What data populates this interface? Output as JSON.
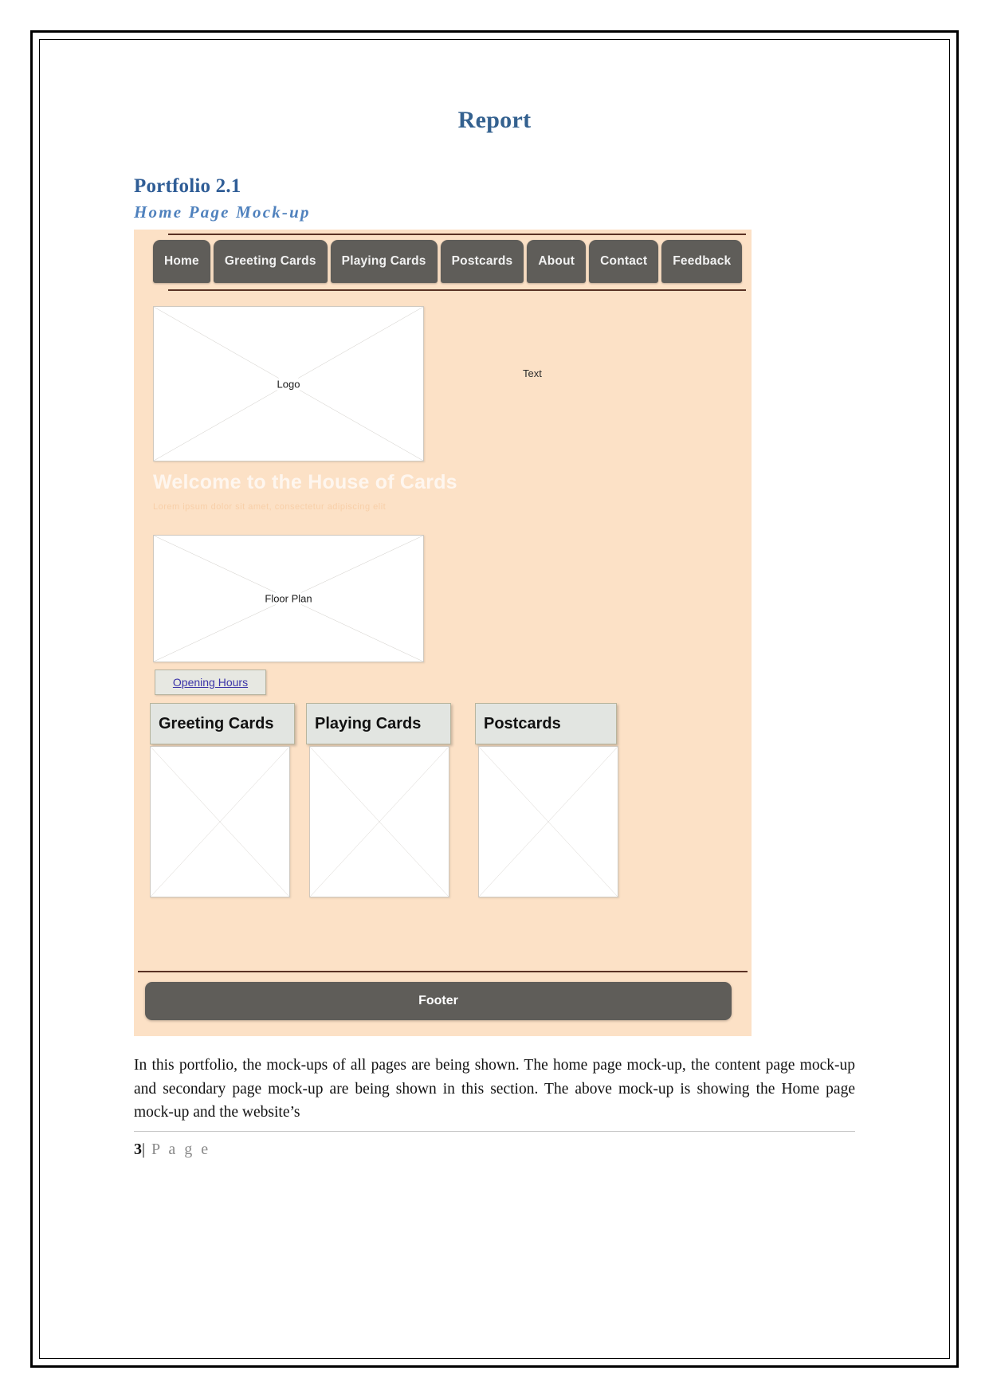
{
  "document": {
    "title": "Report",
    "section_heading": "Portfolio 2.1",
    "sub_heading": "Home Page Mock-up",
    "body_paragraph": "In this portfolio, the mock-ups of all pages are being shown. The home page mock-up, the content page mock-up and secondary page mock-up are being shown in this section. The above mock-up is showing the Home page mock-up and the website’s",
    "page_number": "3",
    "page_separator": "|",
    "page_label": "P a g e"
  },
  "colors": {
    "title_blue": "#34618f",
    "heading_blue": "#2f5d96",
    "subheading_blue": "#4f81bd",
    "mockup_background": "#fce1c6",
    "nav_button": "#5f5d59",
    "footer_bar": "#5f5d59",
    "link_purple": "#3b34a8",
    "rule_brown": "#5a3224",
    "box_gray": "#e2e5e1"
  },
  "mockup": {
    "nav_items": [
      {
        "label": "Home"
      },
      {
        "label": "Greeting Cards"
      },
      {
        "label": "Playing Cards"
      },
      {
        "label": "Postcards"
      },
      {
        "label": "About"
      },
      {
        "label": "Contact"
      },
      {
        "label": "Feedback"
      }
    ],
    "logo_placeholder": "Logo",
    "text_label": "Text",
    "welcome_heading": "Welcome to the House of Cards",
    "welcome_subtext": "Lorem ipsum dolor sit amet, consectetur adipiscing elit",
    "floorplan_placeholder": "Floor Plan",
    "opening_hours_link": "Opening Hours",
    "categories": [
      {
        "label": "Greeting Cards"
      },
      {
        "label": "Playing Cards"
      },
      {
        "label": "Postcards"
      }
    ],
    "footer_label": "Footer"
  }
}
